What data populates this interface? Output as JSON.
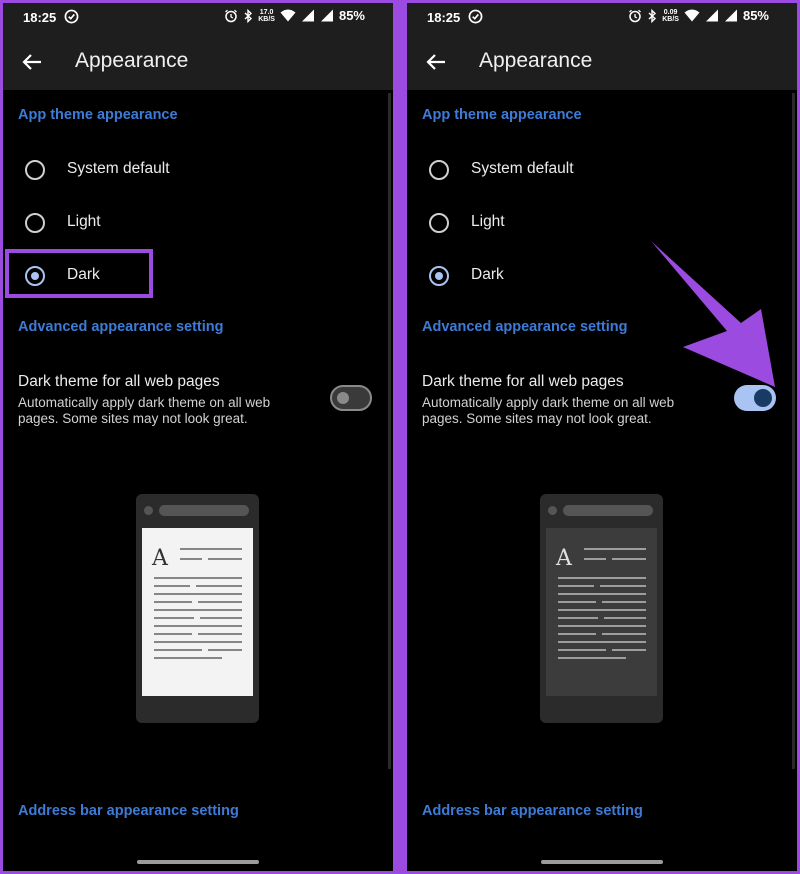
{
  "accent_color": "#3d7bd6",
  "highlight_color": "#9b4be0",
  "screens": [
    {
      "status": {
        "time": "18:25",
        "net_speed_value": "17.0",
        "net_speed_unit": "KB/S",
        "battery": "85%"
      },
      "title": "Appearance",
      "section_theme": "App theme appearance",
      "options": [
        {
          "label": "System default",
          "selected": false
        },
        {
          "label": "Light",
          "selected": false
        },
        {
          "label": "Dark",
          "selected": true
        }
      ],
      "section_advanced": "Advanced appearance setting",
      "dark_web_title": "Dark theme for all web pages",
      "dark_web_desc": "Automatically apply dark theme on all web pages. Some sites may not look great.",
      "dark_web_enabled": false,
      "section_address": "Address bar appearance setting",
      "preview_page_theme": "light",
      "preview_glyph": "A"
    },
    {
      "status": {
        "time": "18:25",
        "net_speed_value": "0.09",
        "net_speed_unit": "KB/S",
        "battery": "85%"
      },
      "title": "Appearance",
      "section_theme": "App theme appearance",
      "options": [
        {
          "label": "System default",
          "selected": false
        },
        {
          "label": "Light",
          "selected": false
        },
        {
          "label": "Dark",
          "selected": true
        }
      ],
      "section_advanced": "Advanced appearance setting",
      "dark_web_title": "Dark theme for all web pages",
      "dark_web_desc": "Automatically apply dark theme on all web pages. Some sites may not look great.",
      "dark_web_enabled": true,
      "section_address": "Address bar appearance setting",
      "preview_page_theme": "dark",
      "preview_glyph": "A"
    }
  ]
}
